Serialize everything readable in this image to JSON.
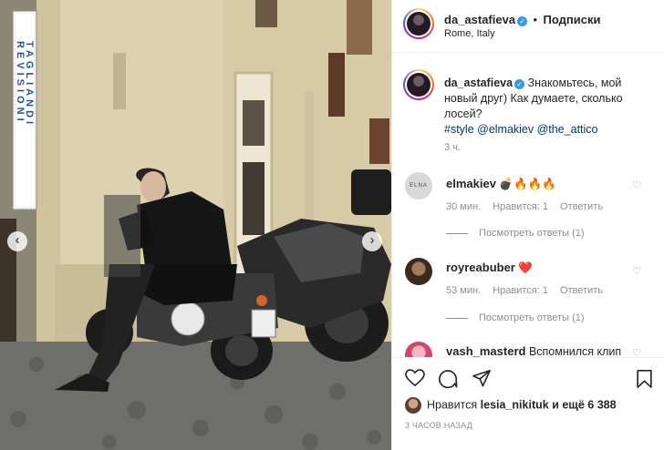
{
  "header": {
    "username": "da_astafieva",
    "separator": "•",
    "follow_label": "Подписки",
    "location": "Rome, Italy"
  },
  "caption": {
    "username": "da_astafieva",
    "text": "Знакомьтесь, мой новый друг) Как думаете, сколько лосей?",
    "hashtags": "#style @elmakiev @the_attico",
    "time": "3 ч."
  },
  "comments": [
    {
      "username": "elmakiev",
      "text": "💣🔥🔥🔥",
      "time": "30 мин.",
      "likes": "Нравится: 1",
      "reply_label": "Ответить",
      "view_replies": "Посмотреть ответы (1)"
    },
    {
      "username": "royreabuber",
      "text": "❤️",
      "time": "53 мин.",
      "likes": "Нравится: 1",
      "reply_label": "Ответить",
      "view_replies": "Посмотреть ответы (1)"
    },
    {
      "username": "vash_masterd",
      "text": "Вспомнился клип"
    }
  ],
  "elmakiev_avatar_text": "ELNA",
  "photo_sign": {
    "line1": "REVISIONI",
    "line2": "TAGLIANDI"
  },
  "likes": {
    "prefix": "Нравится",
    "user": "lesia_nikituk",
    "suffix": "и ещё 6 388"
  },
  "post_time": "3 ЧАСОВ НАЗАД",
  "icons": [
    "verified-badge-icon",
    "heart-icon",
    "comment-icon",
    "share-icon",
    "bookmark-icon",
    "chevron-left-icon",
    "chevron-right-icon"
  ],
  "colors": {
    "accent": "#3897f0",
    "heart_red": "#ed4956",
    "text": "#262626",
    "muted": "#8e8e8e"
  }
}
